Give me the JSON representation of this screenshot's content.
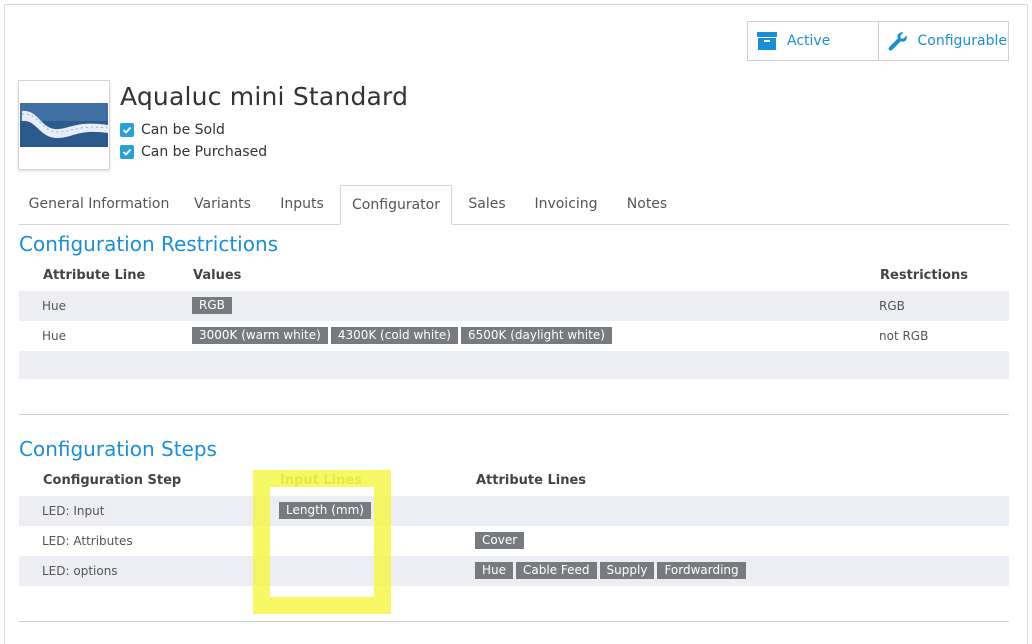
{
  "status_buttons": {
    "active_label": "Active",
    "configurable_label": "Configurable"
  },
  "product": {
    "name": "Aqualuc mini Standard",
    "can_be_sold_label": "Can be Sold",
    "can_be_purchased_label": "Can be Purchased"
  },
  "tabs": [
    {
      "label": "General Information"
    },
    {
      "label": "Variants"
    },
    {
      "label": "Inputs"
    },
    {
      "label": "Configurator"
    },
    {
      "label": "Sales"
    },
    {
      "label": "Invoicing"
    },
    {
      "label": "Notes"
    }
  ],
  "restrictions": {
    "title": "Configuration Restrictions",
    "headers": {
      "attribute_line": "Attribute Line",
      "values": "Values",
      "restrictions": "Restrictions"
    },
    "rows": [
      {
        "attribute": "Hue",
        "values": [
          "RGB"
        ],
        "restriction": "RGB"
      },
      {
        "attribute": "Hue",
        "values": [
          "3000K (warm white)",
          "4300K (cold white)",
          "6500K (daylight white)"
        ],
        "restriction": "not RGB"
      }
    ]
  },
  "steps": {
    "title": "Configuration Steps",
    "headers": {
      "step": "Configuration Step",
      "input_lines": "Input Lines",
      "attribute_lines": "Attribute Lines"
    },
    "rows": [
      {
        "step": "LED: Input",
        "inputs": [
          "Length (mm)"
        ],
        "attributes": []
      },
      {
        "step": "LED: Attributes",
        "inputs": [],
        "attributes": [
          "Cover"
        ]
      },
      {
        "step": "LED: options",
        "inputs": [],
        "attributes": [
          "Hue",
          "Cable Feed",
          "Supply",
          "Fordwarding"
        ]
      }
    ]
  },
  "colors": {
    "accent": "#1a8fd9",
    "tag": "#777a7e",
    "highlight": "#f7f64a"
  }
}
